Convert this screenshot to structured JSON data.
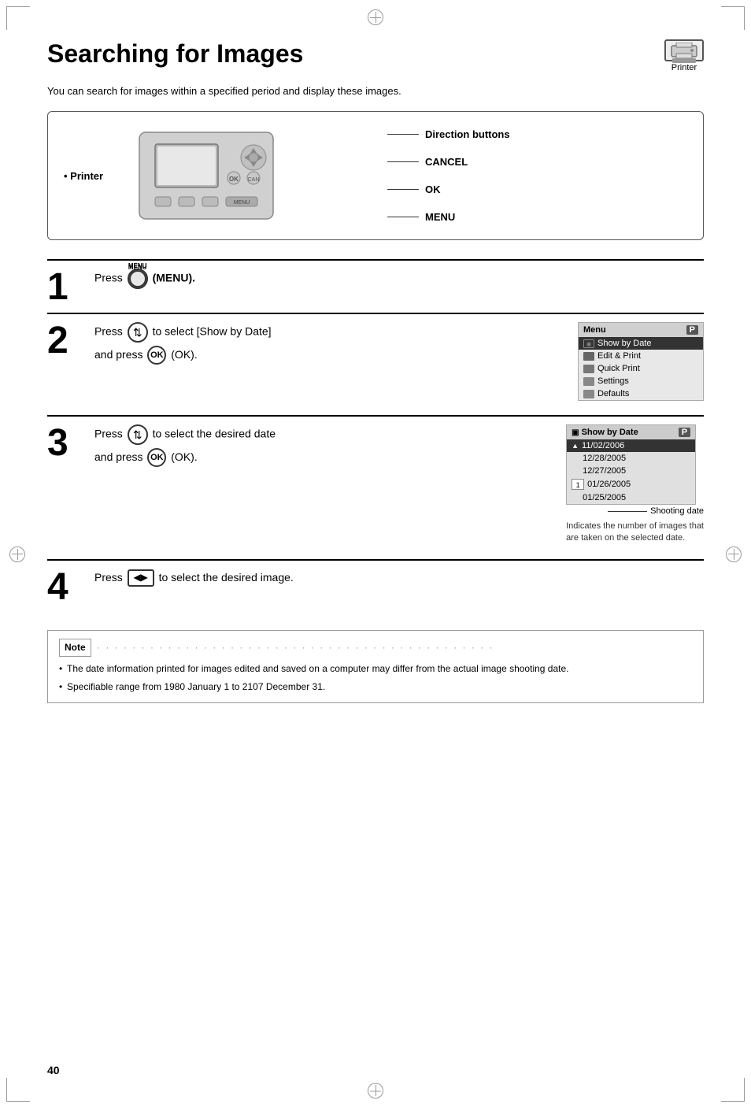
{
  "page": {
    "title": "Searching for Images",
    "subtitle": "You can search for images within a specified period and display these images.",
    "printer_label": "Printer",
    "printer_bullet": "• Printer",
    "callouts": {
      "direction_buttons": "Direction buttons",
      "cancel": "CANCEL",
      "ok": "OK",
      "menu": "MENU"
    },
    "steps": [
      {
        "number": "1",
        "text": "Press",
        "button_label": "MENU",
        "suffix": "(MENU)."
      },
      {
        "number": "2",
        "line1": "Press",
        "line1_suffix": "to select [Show by Date]",
        "line2": "and press",
        "line2_suffix": "(OK)."
      },
      {
        "number": "3",
        "line1": "Press",
        "line1_suffix": "to select the desired date",
        "line2": "and press",
        "line2_suffix": "(OK).",
        "shooting_date_label": "Shooting date",
        "indicates_text": "Indicates the number of images that\nare taken on the selected date."
      },
      {
        "number": "4",
        "text": "Press",
        "suffix": "to select the desired image."
      }
    ],
    "menu_screen": {
      "header_left": "Menu",
      "header_right": "P",
      "items": [
        {
          "icon": "calendar",
          "label": "Show by Date",
          "selected": true
        },
        {
          "icon": "print",
          "label": "Edit & Print",
          "selected": false
        },
        {
          "icon": "print",
          "label": "Quick Print",
          "selected": false
        },
        {
          "icon": "settings",
          "label": "Settings",
          "selected": false
        },
        {
          "icon": "defaults",
          "label": "Defaults",
          "selected": false
        }
      ]
    },
    "date_screen": {
      "header_left": "Show by Date",
      "header_right": "P",
      "dates": [
        {
          "date": "11/02/2006",
          "selected": true,
          "arrow": true,
          "count": ""
        },
        {
          "date": "12/28/2005",
          "selected": false,
          "arrow": false,
          "count": ""
        },
        {
          "date": "12/27/2005",
          "selected": false,
          "arrow": false,
          "count": ""
        },
        {
          "date": "01/26/2005",
          "selected": false,
          "arrow": false,
          "count": "1"
        },
        {
          "date": "01/25/2005",
          "selected": false,
          "arrow": false,
          "count": ""
        }
      ]
    },
    "note": {
      "label": "Note",
      "items": [
        "The date information printed for images edited and saved on a computer may differ from the actual image shooting date.",
        "Specifiable range from 1980 January 1 to 2107 December 31."
      ]
    },
    "page_number": "40"
  }
}
